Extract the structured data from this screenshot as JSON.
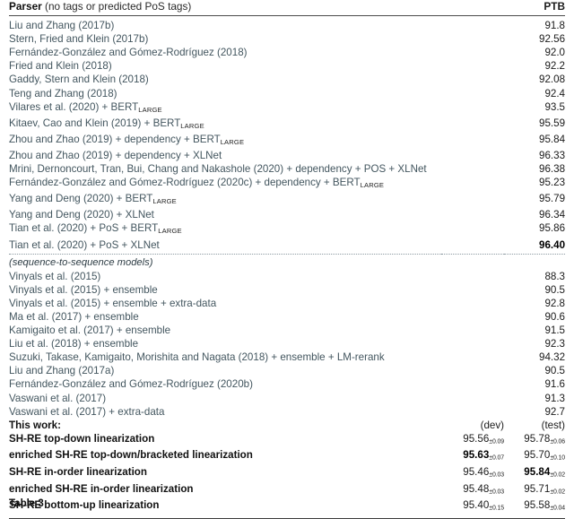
{
  "table": {
    "header": {
      "parser_strong": "Parser",
      "parser_rest": " (no tags or predicted PoS tags)",
      "ptb": "PTB"
    },
    "section_label": "(sequence-to-sequence models)",
    "rows_main": [
      {
        "cite": "Liu and Zhang (2017b)",
        "ptb": "91.8",
        "best": false
      },
      {
        "cite": "Stern, Fried and Klein (2017b)",
        "ptb": "92.56",
        "best": false
      },
      {
        "cite": "Fernández-González and Gómez-Rodríguez (2018)",
        "ptb": "92.0",
        "best": false
      },
      {
        "cite": "Fried and Klein (2018)",
        "ptb": "92.2",
        "best": false
      },
      {
        "cite": "Gaddy, Stern and Klein (2018)",
        "ptb": "92.08",
        "best": false
      },
      {
        "cite": "Teng and Zhang (2018)",
        "ptb": "92.4",
        "best": false
      },
      {
        "cite": "Vilares et al. (2020) + BERT",
        "sub": "Large",
        "ptb": "93.5",
        "best": false
      },
      {
        "cite": "Kitaev, Cao and Klein (2019) + BERT",
        "sub": "Large",
        "ptb": "95.59",
        "best": false
      },
      {
        "cite": "Zhou and Zhao (2019) + dependency + BERT",
        "sub": "Large",
        "ptb": "95.84",
        "best": false
      },
      {
        "cite": "Zhou and Zhao (2019) + dependency + XLNet",
        "ptb": "96.33",
        "best": false
      },
      {
        "cite": "Mrini, Dernoncourt, Tran, Bui, Chang and Nakashole (2020) + dependency + POS + XLNet",
        "ptb": "96.38",
        "best": false
      },
      {
        "cite": "Fernández-González and Gómez-Rodríguez (2020c) + dependency + BERT",
        "sub": "Large",
        "ptb": "95.23",
        "best": false
      },
      {
        "cite": "Yang and Deng (2020) + BERT",
        "sub": "Large",
        "ptb": "95.79",
        "best": false
      },
      {
        "cite": "Yang and Deng (2020) + XLNet",
        "ptb": "96.34",
        "best": false
      },
      {
        "cite": "Tian et al. (2020) + PoS + BERT",
        "sub": "Large",
        "ptb": "95.86",
        "best": false
      },
      {
        "cite": "Tian et al. (2020) + PoS + XLNet",
        "ptb": "96.40",
        "best": true
      }
    ],
    "rows_seq2seq": [
      {
        "cite": "Vinyals et al. (2015)",
        "ptb": "88.3",
        "best": false
      },
      {
        "cite": "Vinyals et al. (2015) + ensemble",
        "ptb": "90.5",
        "best": false
      },
      {
        "cite": "Vinyals et al. (2015) + ensemble + extra-data",
        "ptb": "92.8",
        "best": false
      },
      {
        "cite": "Ma et al. (2017) + ensemble",
        "ptb": "90.6",
        "best": false
      },
      {
        "cite": "Kamigaito et al. (2017) + ensemble",
        "ptb": "91.5",
        "best": false
      },
      {
        "cite": "Liu et al. (2018) + ensemble",
        "ptb": "92.3",
        "best": false
      },
      {
        "cite": "Suzuki, Takase, Kamigaito, Morishita and Nagata (2018) + ensemble + LM-rerank",
        "ptb": "94.32",
        "best": false
      },
      {
        "cite": "Liu and Zhang (2017a)",
        "ptb": "90.5",
        "best": false
      },
      {
        "cite": "Fernández-González and Gómez-Rodríguez (2020b)",
        "ptb": "91.6",
        "best": false
      },
      {
        "cite": "Vaswani et al. (2017)",
        "ptb": "91.3",
        "best": false
      },
      {
        "cite": "Vaswani et al. (2017) + extra-data",
        "ptb": "92.7",
        "best": false
      }
    ],
    "this_work": {
      "title": "This work:",
      "dev_header": "(dev)",
      "test_header": "(test)",
      "rows": [
        {
          "label": "SH-RE top-down linearization",
          "dev_val": "95.56",
          "dev_err": "±0.09",
          "dev_best": false,
          "test_val": "95.78",
          "test_err": "±0.06",
          "test_best": false
        },
        {
          "label": "enriched SH-RE top-down/bracketed linearization",
          "dev_val": "95.63",
          "dev_err": "±0.07",
          "dev_best": true,
          "test_val": "95.70",
          "test_err": "±0.10",
          "test_best": false
        },
        {
          "label": "SH-RE in-order linearization",
          "dev_val": "95.46",
          "dev_err": "±0.03",
          "dev_best": false,
          "test_val": "95.84",
          "test_err": "±0.02",
          "test_best": true
        },
        {
          "label": "enriched SH-RE in-order linearization",
          "dev_val": "95.48",
          "dev_err": "±0.03",
          "dev_best": false,
          "test_val": "95.71",
          "test_err": "±0.02",
          "test_best": false
        },
        {
          "label": "SH-RE bottom-up linearization",
          "dev_val": "95.40",
          "dev_err": "±0.15",
          "dev_best": false,
          "test_val": "95.58",
          "test_err": "±0.04",
          "test_best": false
        }
      ]
    }
  },
  "caption": "Table 3"
}
